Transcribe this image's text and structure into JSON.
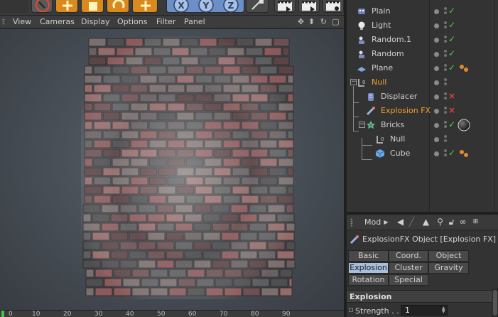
{
  "viewport_menu": {
    "items": [
      "View",
      "Cameras",
      "Display",
      "Options",
      "Filter",
      "Panel"
    ]
  },
  "objects": [
    {
      "name": "Plain",
      "icon": "deformer-icon",
      "state": "check",
      "indent": 0
    },
    {
      "name": "Light",
      "icon": "light-bulb-icon",
      "state": "check",
      "indent": 0
    },
    {
      "name": "Random.1",
      "icon": "random-effector-icon",
      "state": "check",
      "indent": 0
    },
    {
      "name": "Random",
      "icon": "random-effector-icon",
      "state": "check",
      "indent": 0
    },
    {
      "name": "Plane",
      "icon": "plane-icon",
      "state": "check",
      "indent": 0,
      "tag": true
    },
    {
      "name": "Null",
      "icon": "null-icon",
      "state": "none",
      "indent": 0,
      "orange": true
    },
    {
      "name": "Displacer",
      "icon": "displacer-icon",
      "state": "cross",
      "indent": 1
    },
    {
      "name": "Explosion FX",
      "icon": "explosion-fx-icon",
      "state": "cross",
      "indent": 1,
      "orange": true
    },
    {
      "name": "Bricks",
      "icon": "bricks-icon",
      "state": "check",
      "indent": 1,
      "material": true
    },
    {
      "name": "Null",
      "icon": "null-icon",
      "state": "none",
      "indent": 2
    },
    {
      "name": "Cube",
      "icon": "cube-icon",
      "state": "check",
      "indent": 2,
      "tag": true
    }
  ],
  "attribute_manager": {
    "mode_label": "Mod",
    "object_title": "ExplosionFX Object [Explosion FX]",
    "tabs_row1": [
      "Basic",
      "Coord.",
      "Object"
    ],
    "tabs_row2": [
      "Explosion",
      "Cluster",
      "Gravity"
    ],
    "tabs_row3": [
      "Rotation",
      "Special"
    ],
    "active_tab": "Explosion",
    "section": "Explosion",
    "fields": [
      {
        "label": "Strength . .",
        "value": "1"
      }
    ]
  },
  "timeline": {
    "ticks": [
      0,
      10,
      20,
      30,
      40,
      50,
      60,
      70,
      80,
      90
    ]
  },
  "colors": {
    "accent_active_tab": "#a8bedd",
    "orange_selected": "#f0a030",
    "check_green": "#3fd84a",
    "cross_red": "#e04040",
    "brick_red": "#8a5a5c",
    "brick_grey": "#5e5e60"
  }
}
